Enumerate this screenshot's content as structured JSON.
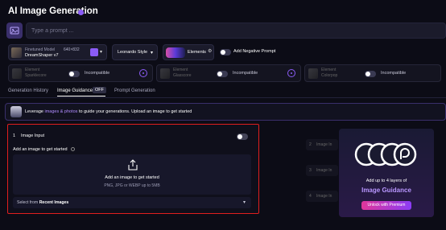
{
  "app": {
    "title": "AI Image Generation"
  },
  "prompt": {
    "placeholder": "Type a prompt ..."
  },
  "model": {
    "label": "Finetuned Model",
    "name": "DreamShaper v7",
    "resolution": "640×832"
  },
  "style": {
    "label": "Leonardo Style"
  },
  "elements": {
    "label": "Elements"
  },
  "negative_prompt": {
    "label": "Add Negative Prompt"
  },
  "element_slots": [
    {
      "name_line1": "Element",
      "name_line2": "Sparklecore",
      "status": "Incompatible"
    },
    {
      "name_line1": "Element",
      "name_line2": "Glasscore",
      "status": "Incompatible"
    },
    {
      "name_line1": "Element",
      "name_line2": "Colorpop",
      "status": "Incompatible"
    }
  ],
  "tabs": [
    {
      "label": "Generation History"
    },
    {
      "label": "Image Guidance",
      "badge": "OFF"
    },
    {
      "label": "Prompt Generation"
    }
  ],
  "banner": {
    "prefix": "Leverage ",
    "link": "images & photos",
    "suffix": " to guide your generations. Upload an image to get started"
  },
  "image_input": {
    "number": "1",
    "title": "Image Input",
    "subtitle": "Add an image to get started",
    "upload_text": "Add an image to get started",
    "upload_hint": "PNG, JPG or WEBP up to 5MB",
    "select_prefix": "Select from ",
    "select_bold": "Recent Images"
  },
  "side_slots": [
    {
      "number": "2",
      "label": "Image In"
    },
    {
      "number": "3",
      "label": "Image In"
    },
    {
      "number": "4",
      "label": "Image In"
    }
  ],
  "promo": {
    "text": "Add up to 4 layers of",
    "title": "Image Guidance",
    "button": "Unlock with Premium"
  },
  "colors": {
    "accent": "#8b5cf6",
    "highlight_border": "#e01e1e"
  }
}
